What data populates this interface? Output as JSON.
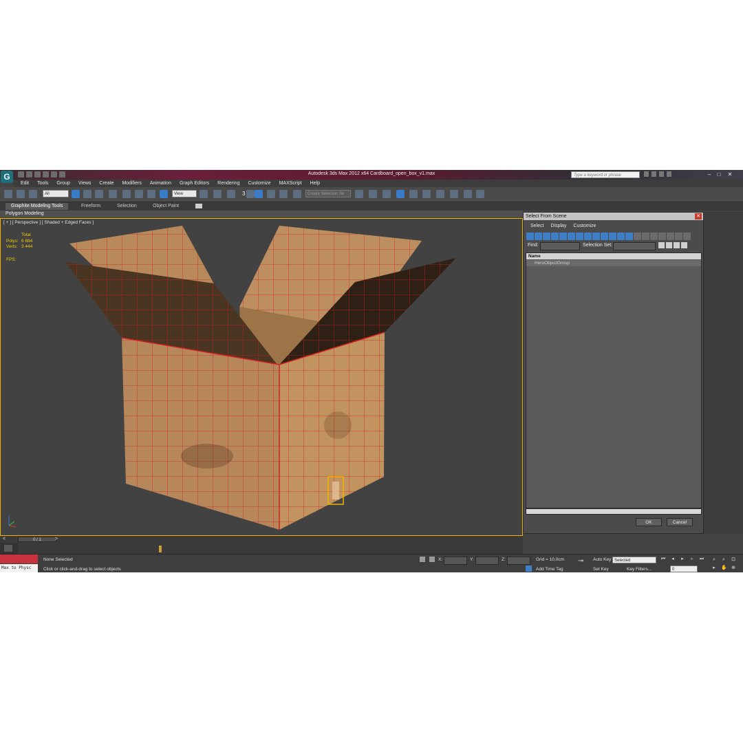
{
  "app": {
    "title": "Autodesk 3ds Max  2012 x64     Cardboard_open_box_v1.max",
    "logo_glyph": "G",
    "search_placeholder": "Type a keyword or phrase",
    "window_buttons": [
      "–",
      "□",
      "✕"
    ]
  },
  "menu": [
    "Edit",
    "Tools",
    "Group",
    "Views",
    "Create",
    "Modifiers",
    "Animation",
    "Graph Editors",
    "Rendering",
    "Customize",
    "MAXScript",
    "Help"
  ],
  "toolbar": {
    "filter_value": "All",
    "coord_value": "View",
    "named_selection_placeholder": "Create Selection Se",
    "snap_label": "3"
  },
  "ribbon": {
    "tabs": [
      "Graphite Modeling Tools",
      "Freeform",
      "Selection",
      "Object Paint"
    ],
    "active_tab": "Graphite Modeling Tools",
    "sub_label": "Polygon Modeling"
  },
  "viewport": {
    "label": "[ + ] [ Perspective ] [ Shaded + Edged Faces ]",
    "stats": {
      "header": "Total",
      "polys_label": "Polys:",
      "polys_value": "6 884",
      "verts_label": "Verts:",
      "verts_value": "3 444",
      "fps_label": "FPS:"
    },
    "colors": {
      "bg": "#424242",
      "cardboard": "#b8895a",
      "edges": "#d42020",
      "selection": "#f2b400"
    }
  },
  "timeline": {
    "frame_label": "0 / 1",
    "nav_prev": "<",
    "nav_next": ">"
  },
  "status": {
    "maxscript": "Max to Physc",
    "selection": "None Selected",
    "prompt": "Click or click-and-drag to select objects",
    "x_label": "X:",
    "y_label": "Y:",
    "z_label": "Z:",
    "grid": "Grid = 10,0cm",
    "add_time_tag": "Add Time Tag",
    "auto_key": "Auto Key",
    "set_key": "Set Key",
    "selected_dropdown": "Selected",
    "key_filters": "Key Filters...",
    "frame_value": "0"
  },
  "dialog": {
    "title": "Select From Scene",
    "close": "✕",
    "menu": [
      "Select",
      "Display",
      "Customize"
    ],
    "find_label": "Find:",
    "selection_set_label": "Selection Set:",
    "column_header": "Name",
    "items": [
      "HeroObjectGroup"
    ],
    "ok": "OK",
    "cancel": "Cancel"
  }
}
